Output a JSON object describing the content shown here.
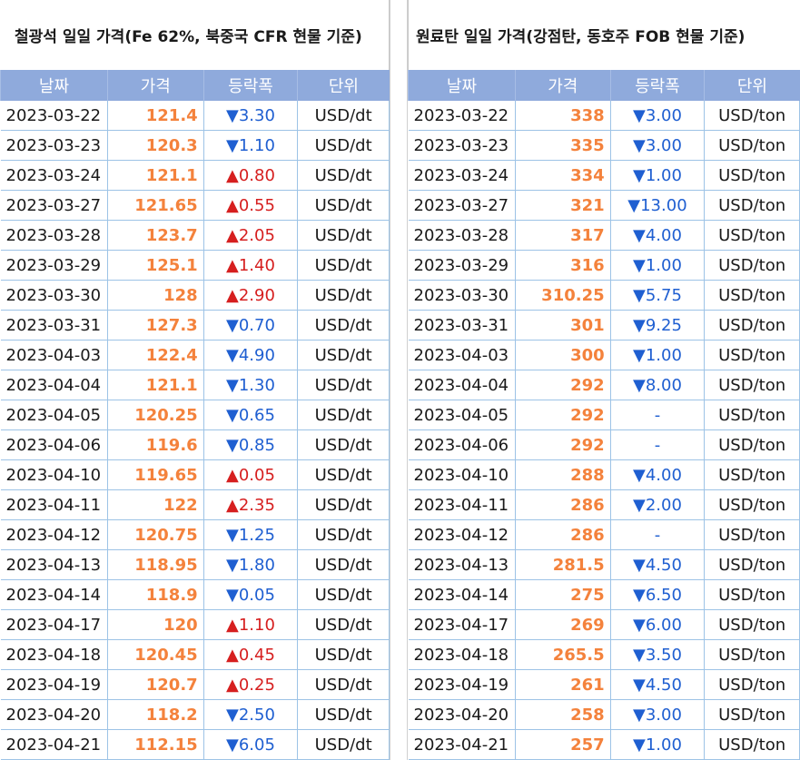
{
  "left": {
    "title": "철광석 일일 가격(Fe 62%, 북중국 CFR 현물 기준)",
    "headers": [
      "날짜",
      "가격",
      "등락폭",
      "단위"
    ],
    "rows": [
      {
        "date": "2023-03-22",
        "price": "121.4",
        "dir": "down",
        "change": "3.30",
        "unit": "USD/dt"
      },
      {
        "date": "2023-03-23",
        "price": "120.3",
        "dir": "down",
        "change": "1.10",
        "unit": "USD/dt"
      },
      {
        "date": "2023-03-24",
        "price": "121.1",
        "dir": "up",
        "change": "0.80",
        "unit": "USD/dt"
      },
      {
        "date": "2023-03-27",
        "price": "121.65",
        "dir": "up",
        "change": "0.55",
        "unit": "USD/dt"
      },
      {
        "date": "2023-03-28",
        "price": "123.7",
        "dir": "up",
        "change": "2.05",
        "unit": "USD/dt"
      },
      {
        "date": "2023-03-29",
        "price": "125.1",
        "dir": "up",
        "change": "1.40",
        "unit": "USD/dt"
      },
      {
        "date": "2023-03-30",
        "price": "128",
        "dir": "up",
        "change": "2.90",
        "unit": "USD/dt"
      },
      {
        "date": "2023-03-31",
        "price": "127.3",
        "dir": "down",
        "change": "0.70",
        "unit": "USD/dt"
      },
      {
        "date": "2023-04-03",
        "price": "122.4",
        "dir": "down",
        "change": "4.90",
        "unit": "USD/dt"
      },
      {
        "date": "2023-04-04",
        "price": "121.1",
        "dir": "down",
        "change": "1.30",
        "unit": "USD/dt"
      },
      {
        "date": "2023-04-05",
        "price": "120.25",
        "dir": "down",
        "change": "0.65",
        "unit": "USD/dt"
      },
      {
        "date": "2023-04-06",
        "price": "119.6",
        "dir": "down",
        "change": "0.85",
        "unit": "USD/dt"
      },
      {
        "date": "2023-04-10",
        "price": "119.65",
        "dir": "up",
        "change": "0.05",
        "unit": "USD/dt"
      },
      {
        "date": "2023-04-11",
        "price": "122",
        "dir": "up",
        "change": "2.35",
        "unit": "USD/dt"
      },
      {
        "date": "2023-04-12",
        "price": "120.75",
        "dir": "down",
        "change": "1.25",
        "unit": "USD/dt"
      },
      {
        "date": "2023-04-13",
        "price": "118.95",
        "dir": "down",
        "change": "1.80",
        "unit": "USD/dt"
      },
      {
        "date": "2023-04-14",
        "price": "118.9",
        "dir": "down",
        "change": "0.05",
        "unit": "USD/dt"
      },
      {
        "date": "2023-04-17",
        "price": "120",
        "dir": "up",
        "change": "1.10",
        "unit": "USD/dt"
      },
      {
        "date": "2023-04-18",
        "price": "120.45",
        "dir": "up",
        "change": "0.45",
        "unit": "USD/dt"
      },
      {
        "date": "2023-04-19",
        "price": "120.7",
        "dir": "up",
        "change": "0.25",
        "unit": "USD/dt"
      },
      {
        "date": "2023-04-20",
        "price": "118.2",
        "dir": "down",
        "change": "2.50",
        "unit": "USD/dt"
      },
      {
        "date": "2023-04-21",
        "price": "112.15",
        "dir": "down",
        "change": "6.05",
        "unit": "USD/dt"
      }
    ]
  },
  "right": {
    "title": "원료탄 일일 가격(강점탄, 동호주 FOB 현물 기준)",
    "headers": [
      "날짜",
      "가격",
      "등락폭",
      "단위"
    ],
    "rows": [
      {
        "date": "2023-03-22",
        "price": "338",
        "dir": "down",
        "change": "3.00",
        "unit": "USD/ton"
      },
      {
        "date": "2023-03-23",
        "price": "335",
        "dir": "down",
        "change": "3.00",
        "unit": "USD/ton"
      },
      {
        "date": "2023-03-24",
        "price": "334",
        "dir": "down",
        "change": "1.00",
        "unit": "USD/ton"
      },
      {
        "date": "2023-03-27",
        "price": "321",
        "dir": "down",
        "change": "13.00",
        "unit": "USD/ton"
      },
      {
        "date": "2023-03-28",
        "price": "317",
        "dir": "down",
        "change": "4.00",
        "unit": "USD/ton"
      },
      {
        "date": "2023-03-29",
        "price": "316",
        "dir": "down",
        "change": "1.00",
        "unit": "USD/ton"
      },
      {
        "date": "2023-03-30",
        "price": "310.25",
        "dir": "down",
        "change": "5.75",
        "unit": "USD/ton"
      },
      {
        "date": "2023-03-31",
        "price": "301",
        "dir": "down",
        "change": "9.25",
        "unit": "USD/ton"
      },
      {
        "date": "2023-04-03",
        "price": "300",
        "dir": "down",
        "change": "1.00",
        "unit": "USD/ton"
      },
      {
        "date": "2023-04-04",
        "price": "292",
        "dir": "down",
        "change": "8.00",
        "unit": "USD/ton"
      },
      {
        "date": "2023-04-05",
        "price": "292",
        "dir": "none",
        "change": "-",
        "unit": "USD/ton"
      },
      {
        "date": "2023-04-06",
        "price": "292",
        "dir": "none",
        "change": "-",
        "unit": "USD/ton"
      },
      {
        "date": "2023-04-10",
        "price": "288",
        "dir": "down",
        "change": "4.00",
        "unit": "USD/ton"
      },
      {
        "date": "2023-04-11",
        "price": "286",
        "dir": "down",
        "change": "2.00",
        "unit": "USD/ton"
      },
      {
        "date": "2023-04-12",
        "price": "286",
        "dir": "none",
        "change": "-",
        "unit": "USD/ton"
      },
      {
        "date": "2023-04-13",
        "price": "281.5",
        "dir": "down",
        "change": "4.50",
        "unit": "USD/ton"
      },
      {
        "date": "2023-04-14",
        "price": "275",
        "dir": "down",
        "change": "6.50",
        "unit": "USD/ton"
      },
      {
        "date": "2023-04-17",
        "price": "269",
        "dir": "down",
        "change": "6.00",
        "unit": "USD/ton"
      },
      {
        "date": "2023-04-18",
        "price": "265.5",
        "dir": "down",
        "change": "3.50",
        "unit": "USD/ton"
      },
      {
        "date": "2023-04-19",
        "price": "261",
        "dir": "down",
        "change": "4.50",
        "unit": "USD/ton"
      },
      {
        "date": "2023-04-20",
        "price": "258",
        "dir": "down",
        "change": "3.00",
        "unit": "USD/ton"
      },
      {
        "date": "2023-04-21",
        "price": "257",
        "dir": "down",
        "change": "1.00",
        "unit": "USD/ton"
      }
    ]
  },
  "style": {
    "header_bg": "#8faadc",
    "price_color": "#f4823c",
    "down_color": "#1f5fd1",
    "up_color": "#d61f1f",
    "up_icon": "triangle-up-icon",
    "down_icon": "triangle-down-icon"
  }
}
